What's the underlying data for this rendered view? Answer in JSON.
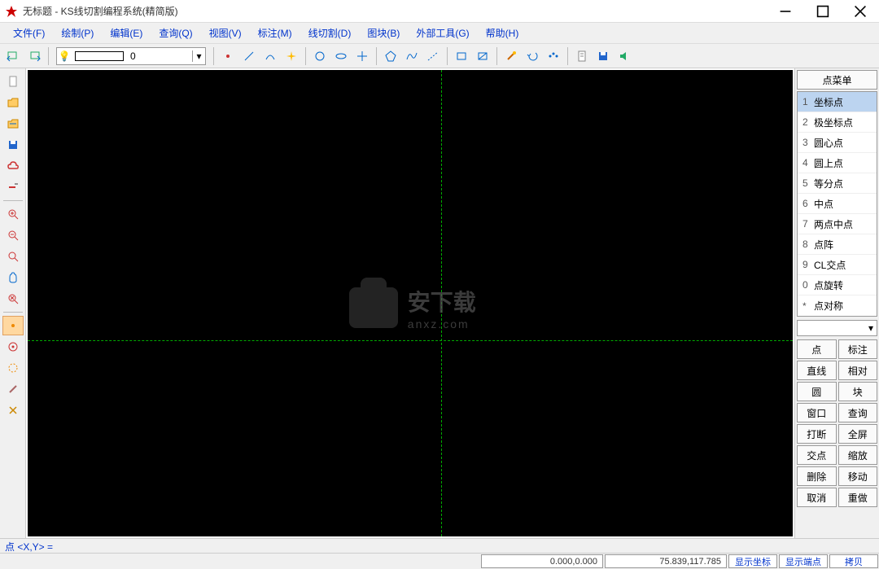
{
  "title": "无标题 - KS线切割编程系统(精简版)",
  "menu": [
    "文件(F)",
    "绘制(P)",
    "编辑(E)",
    "查询(Q)",
    "视图(V)",
    "标注(M)",
    "线切割(D)",
    "图块(B)",
    "外部工具(G)",
    "帮助(H)"
  ],
  "layer": {
    "value": "0"
  },
  "toolbar_icons": {
    "prev": "prev-icon",
    "next": "next-icon",
    "dot": "dot-icon",
    "line": "line-icon",
    "arc": "arc-icon",
    "star": "star-icon",
    "circle": "circle-icon",
    "ellipse": "ellipse-icon",
    "cross": "cross-icon",
    "poly": "pentagon-icon",
    "wave": "curve-icon",
    "dash": "dashed-icon",
    "rect": "rect-icon",
    "rect2": "rect2-icon",
    "wand": "wand-icon",
    "undo": "undo-icon",
    "redo": "redo-icon",
    "doc": "doc-icon",
    "save": "save-icon",
    "speaker": "speaker-icon"
  },
  "left_icons": [
    {
      "name": "new-file-icon"
    },
    {
      "name": "open-folder-icon"
    },
    {
      "name": "open2-folder-icon"
    },
    {
      "name": "save-disk-icon"
    },
    {
      "name": "cloud-icon"
    },
    {
      "name": "erase-icon"
    },
    {
      "sep": true
    },
    {
      "name": "zoom-in-icon"
    },
    {
      "name": "zoom-out-icon"
    },
    {
      "name": "zoom-fit-icon"
    },
    {
      "name": "pan-icon"
    },
    {
      "name": "zoom-reset-icon"
    },
    {
      "sep": true
    },
    {
      "name": "ring1-icon",
      "sel": true
    },
    {
      "name": "ring2-icon"
    },
    {
      "name": "ring3-icon"
    },
    {
      "name": "brush-icon"
    },
    {
      "name": "xmark-icon"
    }
  ],
  "right": {
    "header": "点菜单",
    "items": [
      {
        "idx": "1",
        "label": "坐标点",
        "sel": true
      },
      {
        "idx": "2",
        "label": "极坐标点"
      },
      {
        "idx": "3",
        "label": "圆心点"
      },
      {
        "idx": "4",
        "label": "圆上点"
      },
      {
        "idx": "5",
        "label": "等分点"
      },
      {
        "idx": "6",
        "label": "中点"
      },
      {
        "idx": "7",
        "label": "两点中点"
      },
      {
        "idx": "8",
        "label": "点阵"
      },
      {
        "idx": "9",
        "label": "CL交点"
      },
      {
        "idx": "0",
        "label": "点旋转"
      },
      {
        "idx": "*",
        "label": "点对称"
      }
    ],
    "buttons": [
      "点",
      "标注",
      "直线",
      "相对",
      "圆",
      "块",
      "窗口",
      "查询",
      "打断",
      "全屏",
      "交点",
      "缩放",
      "删除",
      "移动",
      "取消",
      "重做"
    ]
  },
  "cmdline": "点 <X,Y> =",
  "status": {
    "coord1": "0.000,0.000",
    "coord2": "75.839,117.785",
    "btn1": "显示坐标",
    "btn2": "显示端点",
    "btn3": "拷贝"
  },
  "watermark": {
    "big": "安下载",
    "small": "anxz.com"
  }
}
